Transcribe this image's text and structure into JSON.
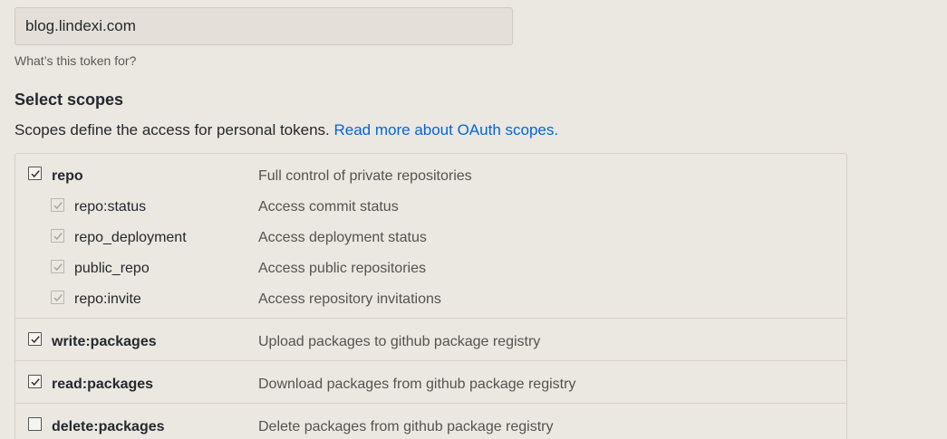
{
  "note": {
    "value": "blog.lindexi.com",
    "help": "What’s this token for?"
  },
  "scopes": {
    "heading": "Select scopes",
    "description": "Scopes define the access for personal tokens.",
    "link": "Read more about OAuth scopes.",
    "repo": {
      "name": "repo",
      "desc": "Full control of private repositories",
      "checked": true,
      "children": [
        {
          "name": "repo:status",
          "desc": "Access commit status",
          "checked": true
        },
        {
          "name": "repo_deployment",
          "desc": "Access deployment status",
          "checked": true
        },
        {
          "name": "public_repo",
          "desc": "Access public repositories",
          "checked": true
        },
        {
          "name": "repo:invite",
          "desc": "Access repository invitations",
          "checked": true
        }
      ]
    },
    "write_packages": {
      "name": "write:packages",
      "desc": "Upload packages to github package registry",
      "checked": true
    },
    "read_packages": {
      "name": "read:packages",
      "desc": "Download packages from github package registry",
      "checked": true
    },
    "delete_packages": {
      "name": "delete:packages",
      "desc": "Delete packages from github package registry",
      "checked": false
    }
  }
}
